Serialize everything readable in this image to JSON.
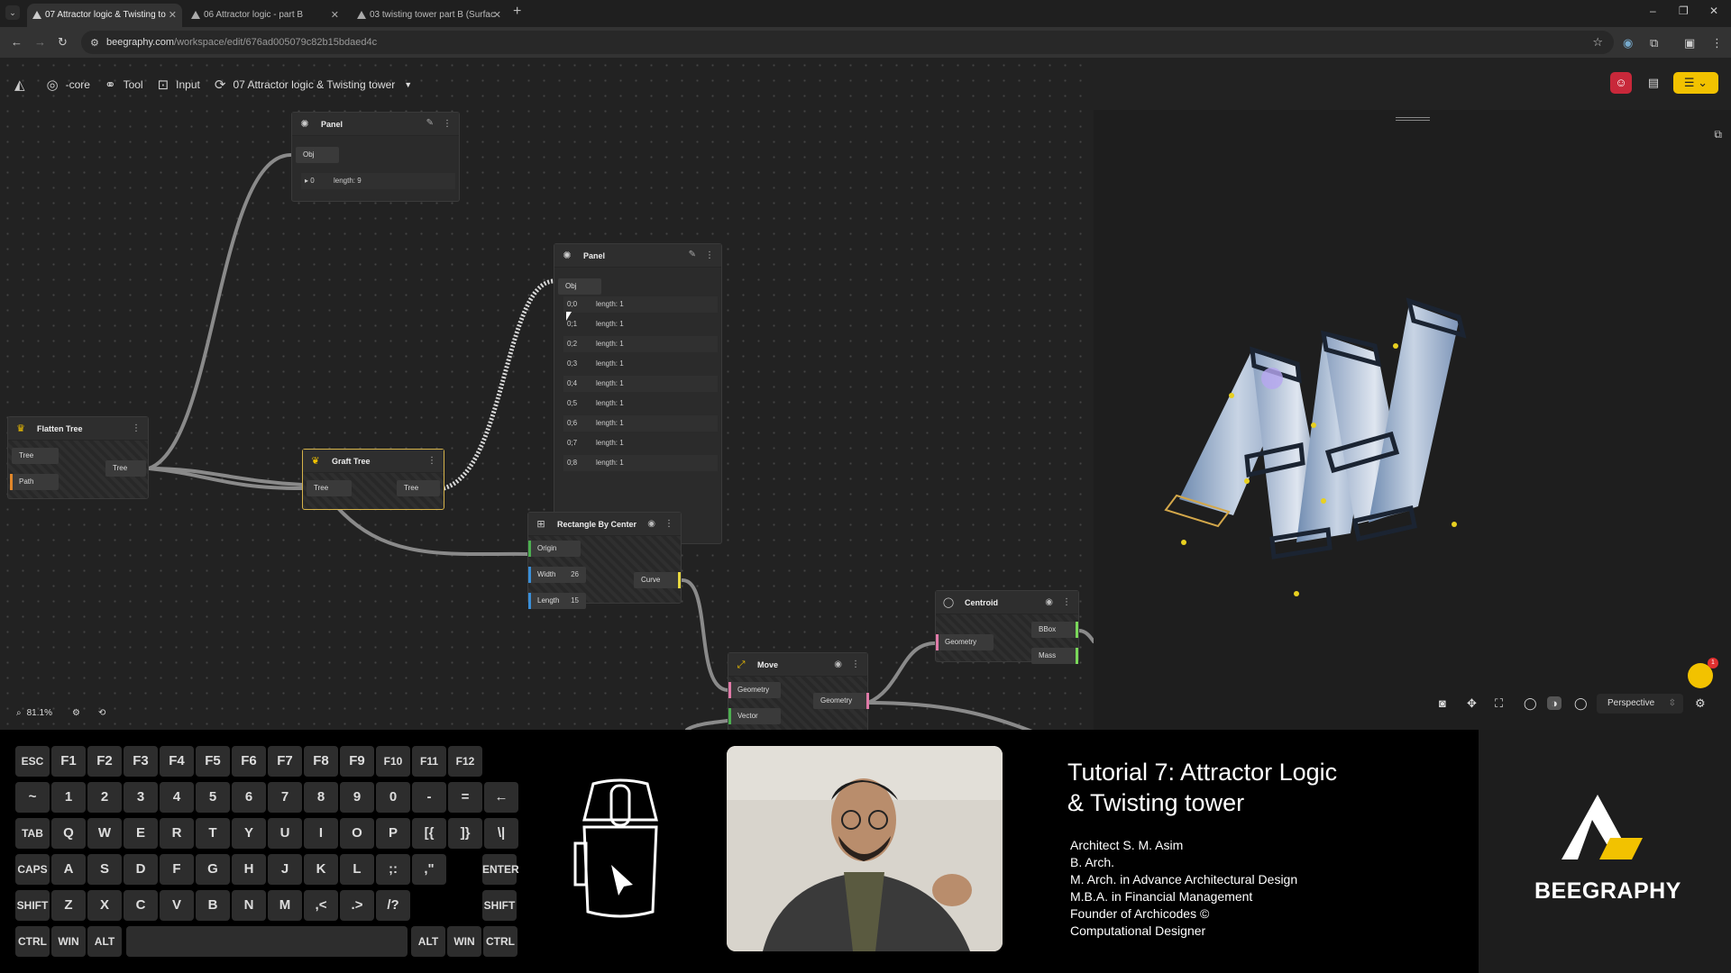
{
  "browser": {
    "tabs": [
      {
        "label": "07 Attractor logic & Twisting to",
        "active": true
      },
      {
        "label": "06 Attractor logic - part B",
        "active": false
      },
      {
        "label": "03 twisting tower part B (Surfac",
        "active": false
      }
    ],
    "url_host": "beegraphy.com",
    "url_path": "/workspace/edit/676ad005079c82b15bdaed4c"
  },
  "toolbar": {
    "core_label": "-core",
    "tool_label": "Tool",
    "input_label": "Input",
    "project_title": "07 Attractor logic & Twisting tower"
  },
  "nodes": {
    "panel1": {
      "title": "Panel",
      "port": "Obj",
      "rows": [
        {
          "idx": "0",
          "len": "length: 9"
        }
      ]
    },
    "panel2": {
      "title": "Panel",
      "port": "Obj",
      "rows": [
        {
          "idx": "0;0",
          "len": "length: 1"
        },
        {
          "idx": "0;1",
          "len": "length: 1"
        },
        {
          "idx": "0;2",
          "len": "length: 1"
        },
        {
          "idx": "0;3",
          "len": "length: 1"
        },
        {
          "idx": "0;4",
          "len": "length: 1"
        },
        {
          "idx": "0;5",
          "len": "length: 1"
        },
        {
          "idx": "0;6",
          "len": "length: 1"
        },
        {
          "idx": "0;7",
          "len": "length: 1"
        },
        {
          "idx": "0;8",
          "len": "length: 1"
        }
      ]
    },
    "flatten": {
      "title": "Flatten Tree",
      "in1": "Tree",
      "in2": "Path",
      "out": "Tree"
    },
    "graft": {
      "title": "Graft Tree",
      "in": "Tree",
      "out": "Tree"
    },
    "rect": {
      "title": "Rectangle By Center",
      "origin": "Origin",
      "width": "Width",
      "width_val": "26",
      "length": "Length",
      "length_val": "15",
      "out": "Curve"
    },
    "centroid": {
      "title": "Centroid",
      "in": "Geometry",
      "out1": "BBox",
      "out2": "Mass"
    },
    "move": {
      "title": "Move",
      "in1": "Geometry",
      "in2": "Vector",
      "out": "Geometry"
    }
  },
  "zoom": "81.1%",
  "viewport": {
    "mode": "Perspective"
  },
  "chat_badge": "1",
  "keyboard": {
    "rows": [
      [
        "ESC",
        "F1",
        "F2",
        "F3",
        "F4",
        "F5",
        "F6",
        "F7",
        "F8",
        "F9",
        "F10",
        "F11",
        "F12"
      ],
      [
        "~",
        "1",
        "2",
        "3",
        "4",
        "5",
        "6",
        "7",
        "8",
        "9",
        "0",
        "-",
        "=",
        "←"
      ],
      [
        "TAB",
        "Q",
        "W",
        "E",
        "R",
        "T",
        "Y",
        "U",
        "I",
        "O",
        "P",
        "[{",
        "]}",
        "\\|"
      ],
      [
        "CAPS",
        "A",
        "S",
        "D",
        "F",
        "G",
        "H",
        "J",
        "K",
        "L",
        ";:",
        ",\""
      ],
      [
        "SHIFT",
        "Z",
        "X",
        "C",
        "V",
        "B",
        "N",
        "M",
        ",<",
        ".>",
        "/?"
      ],
      [
        "CTRL",
        "WIN",
        "ALT",
        "ALT",
        "WIN",
        "CTRL"
      ]
    ],
    "enter": "ENTER",
    "shift_right": "SHIFT"
  },
  "overlay": {
    "title_line1": "Tutorial 7: Attractor Logic",
    "title_line2": "& Twisting tower",
    "credits": [
      "Architect S. M. Asim",
      "B. Arch.",
      "M. Arch. in Advance Architectural Design",
      "M.B.A. in Financial Management",
      "Founder of Archicodes ©",
      "Computational Designer"
    ],
    "brand": "BEEGRAPHY"
  },
  "colors": {
    "accent": "#f2c200",
    "selection": "#d6b34a",
    "danger": "#e03030"
  }
}
